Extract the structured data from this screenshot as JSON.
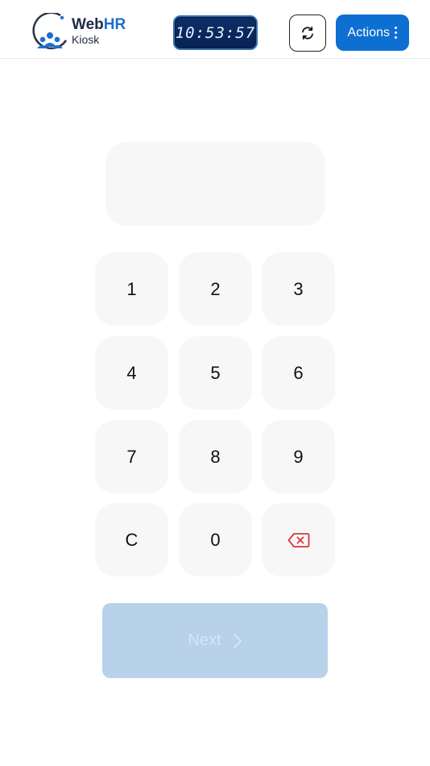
{
  "header": {
    "logo_primary": "Web",
    "logo_accent": "HR",
    "logo_sub": "Kiosk",
    "clock_time": "10:53:57",
    "refresh_icon": "refresh-icon",
    "actions_label": "Actions",
    "actions_icon": "kebab-menu-icon"
  },
  "pin": {
    "value": ""
  },
  "keypad": {
    "keys": [
      "1",
      "2",
      "3",
      "4",
      "5",
      "6",
      "7",
      "8",
      "9",
      "C",
      "0"
    ],
    "backspace_icon": "backspace-icon"
  },
  "next": {
    "label": "Next",
    "icon": "chevron-right-icon"
  },
  "colors": {
    "brand_blue": "#0d6fd1",
    "key_bg": "#f7f7f7",
    "next_disabled_bg": "#b7d2e9",
    "backspace_red": "#d9363e"
  }
}
